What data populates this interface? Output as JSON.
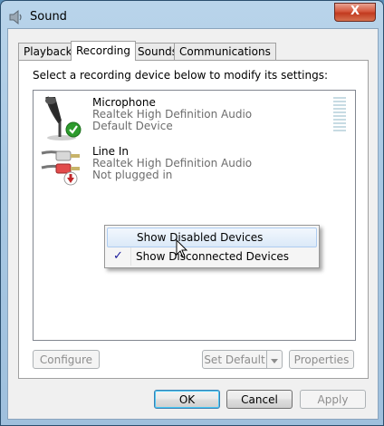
{
  "window": {
    "title": "Sound",
    "close_label": "X"
  },
  "tabs": [
    {
      "label": "Playback",
      "active": false
    },
    {
      "label": "Recording",
      "active": true
    },
    {
      "label": "Sounds",
      "active": false
    },
    {
      "label": "Communications",
      "active": false
    }
  ],
  "recording": {
    "instruction": "Select a recording device below to modify its settings:",
    "devices": [
      {
        "name": "Microphone",
        "driver": "Realtek High Definition Audio",
        "status": "Default Device",
        "icon": "microphone-icon",
        "badge": "default-check-icon"
      },
      {
        "name": "Line In",
        "driver": "Realtek High Definition Audio",
        "status": "Not plugged in",
        "icon": "line-in-cable-icon",
        "badge": "unplugged-arrow-icon"
      }
    ]
  },
  "context_menu": {
    "items": [
      {
        "label": "Show Disabled Devices",
        "checked": false,
        "hovered": true
      },
      {
        "label": "Show Disconnected Devices",
        "checked": true,
        "hovered": false
      }
    ],
    "check_glyph": "✓"
  },
  "panel_buttons": {
    "configure": "Configure",
    "set_default": "Set Default",
    "properties": "Properties"
  },
  "dialog_buttons": {
    "ok": "OK",
    "cancel": "Cancel",
    "apply": "Apply"
  },
  "colors": {
    "title_gradient": "#a9c9e4",
    "close_red": "#c23a1f",
    "menu_hover": "#dbe9f8",
    "default_check_green": "#2d9b2d",
    "unplugged_red": "#c0282a"
  }
}
